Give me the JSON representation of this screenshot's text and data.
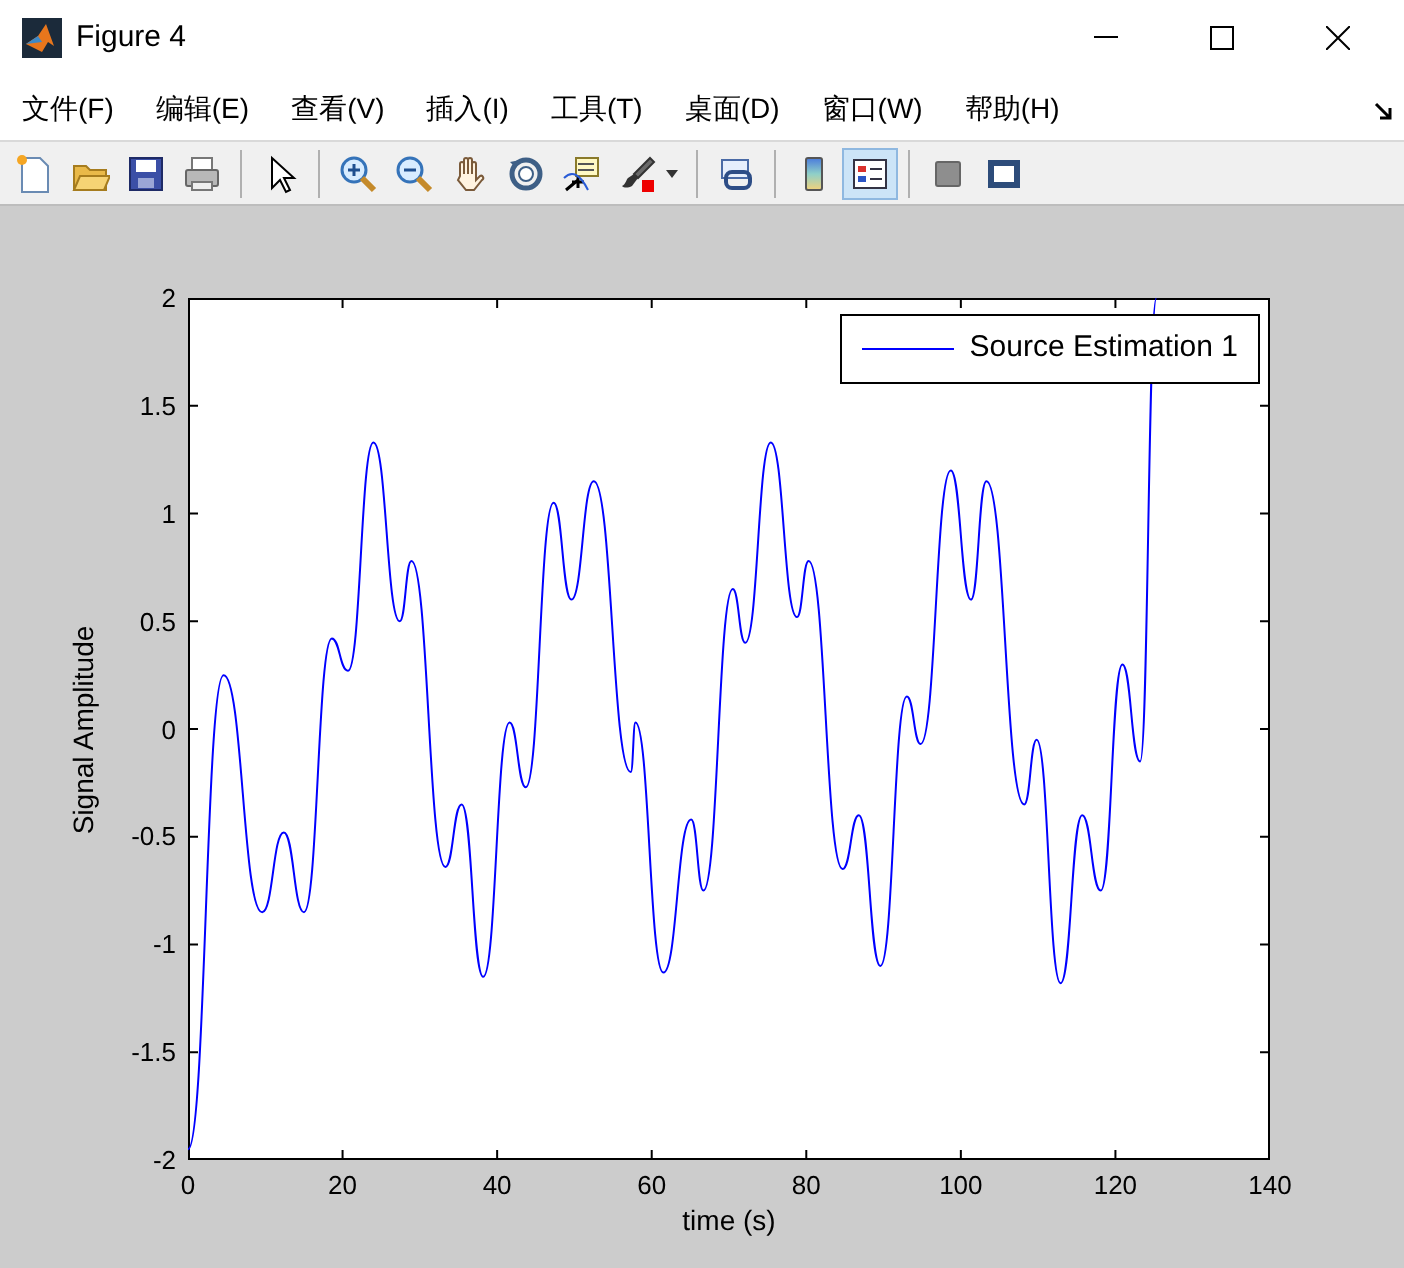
{
  "window": {
    "title": "Figure 4"
  },
  "menu": [
    "文件(F)",
    "编辑(E)",
    "查看(V)",
    "插入(I)",
    "工具(T)",
    "桌面(D)",
    "窗口(W)",
    "帮助(H)"
  ],
  "toolbar": [
    [
      {
        "kind": "new",
        "pressed": false
      },
      {
        "kind": "open",
        "pressed": false
      },
      {
        "kind": "save",
        "pressed": false
      },
      {
        "kind": "print",
        "pressed": false
      }
    ],
    [
      {
        "kind": "pointer",
        "pressed": false
      }
    ],
    [
      {
        "kind": "zoomin",
        "pressed": false
      },
      {
        "kind": "zoomout",
        "pressed": false
      },
      {
        "kind": "pan",
        "pressed": false
      },
      {
        "kind": "rotate",
        "pressed": false
      },
      {
        "kind": "datacursor",
        "pressed": false
      },
      {
        "kind": "brush",
        "pressed": false
      }
    ],
    [
      {
        "kind": "link",
        "pressed": false
      }
    ],
    [
      {
        "kind": "colorbar",
        "pressed": false
      },
      {
        "kind": "legend",
        "pressed": true
      }
    ],
    [
      {
        "kind": "hide",
        "pressed": false
      },
      {
        "kind": "show",
        "pressed": false
      }
    ]
  ],
  "plot": {
    "chart_data": {
      "type": "line",
      "xlabel": "time (s)",
      "ylabel": "Signal Amplitude",
      "xlim": [
        0,
        140
      ],
      "ylim": [
        -2,
        2
      ],
      "xticks": [
        0,
        20,
        40,
        60,
        80,
        100,
        120,
        140
      ],
      "yticks": [
        -2,
        -1.5,
        -1,
        -0.5,
        0,
        0.5,
        1,
        1.5,
        2
      ],
      "x": [
        0,
        4.6,
        9.6,
        12.4,
        15,
        18.6,
        20.7,
        24,
        27.4,
        28.9,
        33.3,
        35.4,
        38.2,
        41.6,
        43.7,
        47.3,
        49.6,
        52.5,
        57.3,
        57.9,
        61.5,
        65.1,
        66.7,
        70.5,
        72.1,
        75.4,
        78.8,
        80.3,
        84.7,
        86.8,
        89.6,
        93,
        94.8,
        98.7,
        101.3,
        103.3,
        108.2,
        109.8,
        112.9,
        115.7,
        118.1,
        120.9,
        123.2,
        125.3
      ],
      "series": [
        {
          "name": "Source Estimation 1",
          "color": "#0000ff",
          "values": [
            -1.95,
            0.25,
            -0.85,
            -0.48,
            -0.85,
            0.42,
            0.27,
            1.33,
            0.5,
            0.78,
            -0.64,
            -0.35,
            -1.15,
            0.03,
            -0.27,
            1.05,
            0.6,
            1.15,
            -0.2,
            0.03,
            -1.13,
            -0.42,
            -0.75,
            0.65,
            0.4,
            1.33,
            0.52,
            0.78,
            -0.65,
            -0.4,
            -1.1,
            0.15,
            -0.07,
            1.2,
            0.6,
            1.15,
            -0.35,
            -0.05,
            -1.18,
            -0.4,
            -0.75,
            0.3,
            -0.15,
            2
          ]
        }
      ]
    }
  }
}
